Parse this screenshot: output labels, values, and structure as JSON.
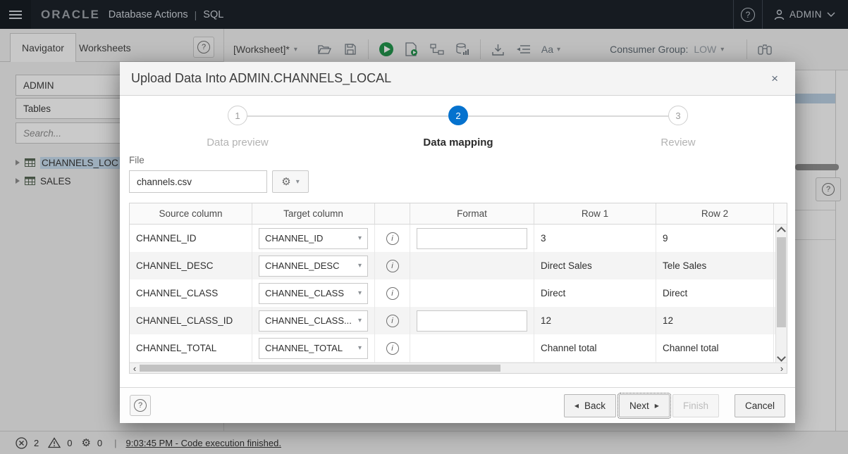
{
  "icons": {
    "caret_down": "▾",
    "close": "×",
    "help": "?",
    "gear": "⚙",
    "chevron_left": "‹",
    "chevron_right": "›",
    "back_arrow": "◀",
    "next_arrow": "▶",
    "info": "i",
    "pipe": "|"
  },
  "colors": {
    "accent_blue": "#0572ce",
    "topbar_bg": "#131a22",
    "run_green": "#1b9447",
    "selection": "#c5dcee"
  },
  "topbar": {
    "logo": "ORACLE",
    "app_title": "Database Actions",
    "separator": "|",
    "context": "SQL",
    "user": "ADMIN"
  },
  "navigator": {
    "tabs": [
      {
        "label": "Navigator"
      },
      {
        "label": "Worksheets"
      }
    ],
    "schema_select": "ADMIN",
    "object_type_select": "Tables",
    "search_placeholder": "Search...",
    "tree": [
      {
        "label": "CHANNELS_LOC",
        "selected": true
      },
      {
        "label": "SALES",
        "selected": false
      }
    ]
  },
  "toolbar": {
    "worksheet_label": "[Worksheet]*",
    "font_label": "Aa",
    "consumer_group_label": "Consumer Group:",
    "consumer_group_value": "LOW"
  },
  "dialog": {
    "title": "Upload Data Into ADMIN.CHANNELS_LOCAL",
    "steps": [
      {
        "number": "1",
        "label": "Data preview",
        "active": false
      },
      {
        "number": "2",
        "label": "Data mapping",
        "active": true
      },
      {
        "number": "3",
        "label": "Review",
        "active": false
      }
    ],
    "file_label": "File",
    "file_value": "channels.csv",
    "table": {
      "headers": {
        "source": "Source column",
        "target": "Target column",
        "info": "",
        "format": "Format",
        "row1": "Row 1",
        "row2": "Row 2"
      },
      "rows": [
        {
          "source": "CHANNEL_ID",
          "target": "CHANNEL_ID",
          "format": "",
          "row1": "3",
          "row2": "9"
        },
        {
          "source": "CHANNEL_DESC",
          "target": "CHANNEL_DESC",
          "row1": "Direct Sales",
          "row2": "Tele Sales"
        },
        {
          "source": "CHANNEL_CLASS",
          "target": "CHANNEL_CLASS",
          "row1": "Direct",
          "row2": "Direct"
        },
        {
          "source": "CHANNEL_CLASS_ID",
          "target": "CHANNEL_CLASS...",
          "format": "",
          "row1": "12",
          "row2": "12"
        },
        {
          "source": "CHANNEL_TOTAL",
          "target": "CHANNEL_TOTAL",
          "row1": "Channel total",
          "row2": "Channel total"
        }
      ]
    },
    "buttons": {
      "back": "Back",
      "next": "Next",
      "finish": "Finish",
      "cancel": "Cancel"
    }
  },
  "statusbar": {
    "errors": "2",
    "warnings": "0",
    "processes": "0",
    "separator": "|",
    "message": "9:03:45 PM - Code execution finished."
  }
}
